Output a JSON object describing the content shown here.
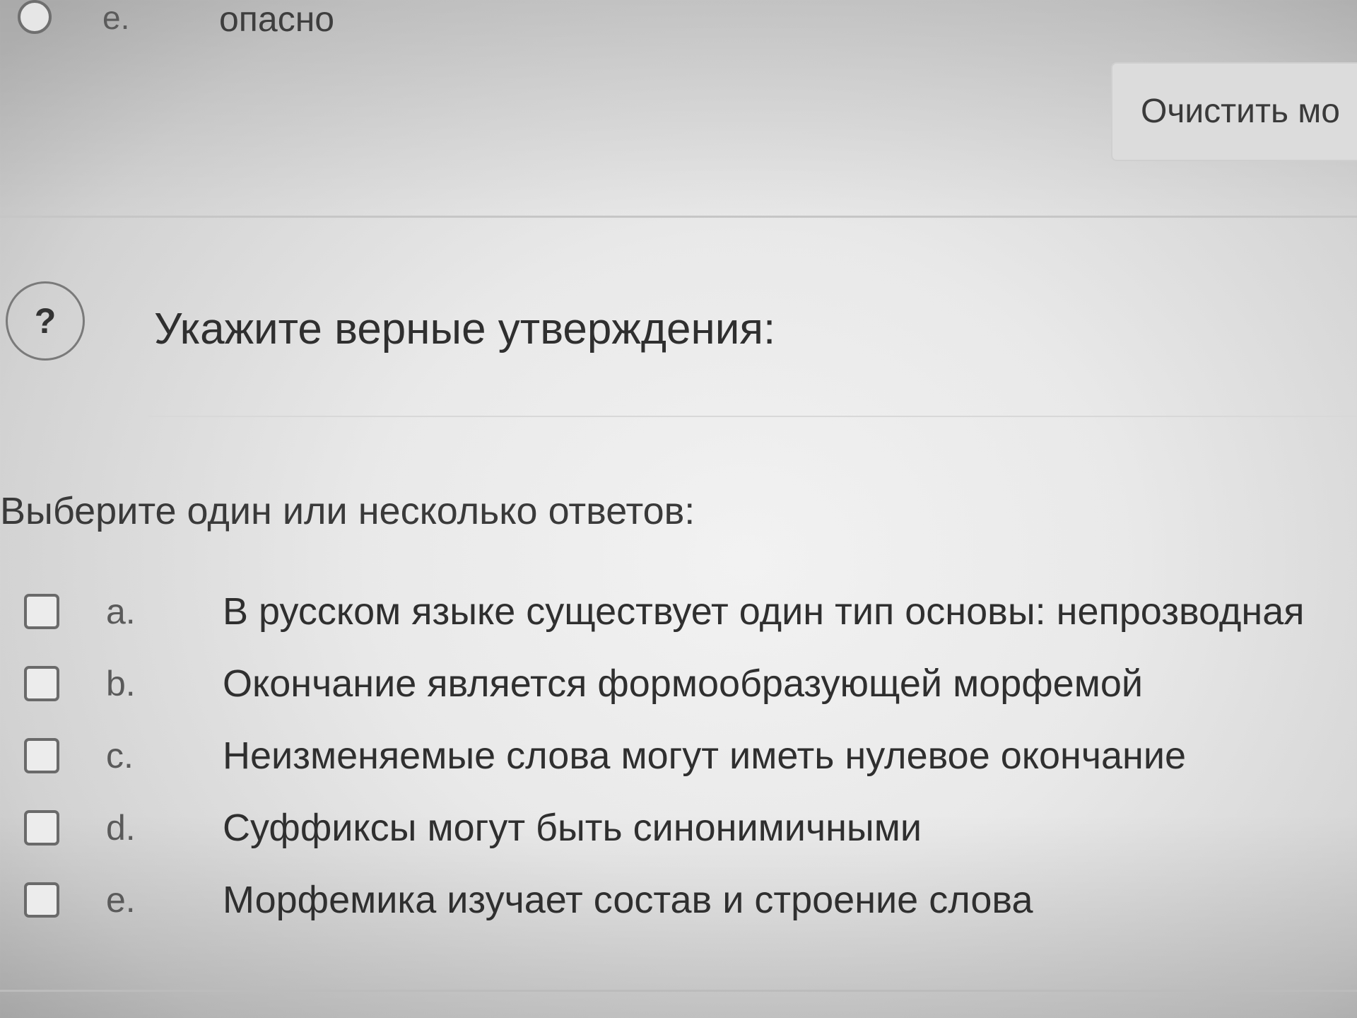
{
  "previous_question": {
    "option_letter": "e.",
    "option_text": "опасно"
  },
  "clear_button_label": "Очистить мо",
  "question": {
    "icon_symbol": "?",
    "text": "Укажите верные утверждения:"
  },
  "prompt": "Выберите один или несколько ответов:",
  "answers": [
    {
      "letter": "a.",
      "text": "В русском языке существует один тип основы: непрозводная"
    },
    {
      "letter": "b.",
      "text": "Окончание является формообразующей морфемой"
    },
    {
      "letter": "c.",
      "text": "Неизменяемые слова могут иметь нулевое окончание"
    },
    {
      "letter": "d.",
      "text": "Суффиксы могут быть синонимичными"
    },
    {
      "letter": "e.",
      "text": "Морфемика изучает состав и строение слова"
    }
  ]
}
